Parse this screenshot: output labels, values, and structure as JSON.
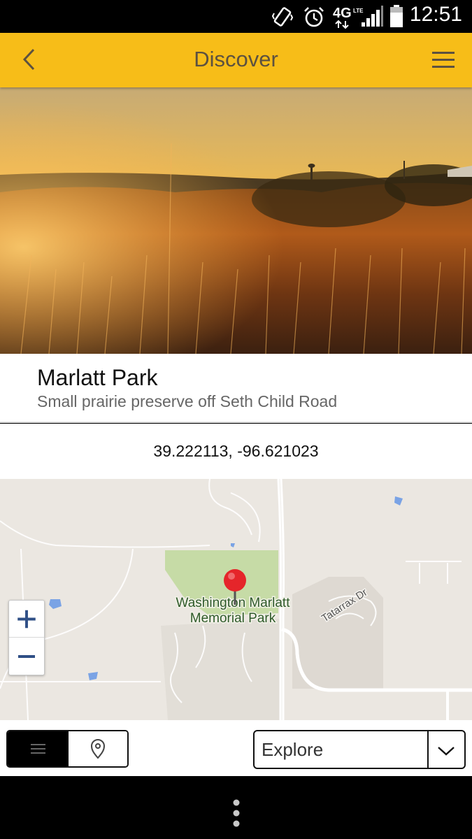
{
  "status_bar": {
    "time": "12:51",
    "network": "4G",
    "icons": [
      "vibrate-icon",
      "alarm-icon",
      "4g-lte-icon",
      "signal-icon",
      "battery-icon"
    ]
  },
  "app_bar": {
    "title": "Discover",
    "back_icon": "chevron-left-icon",
    "menu_icon": "hamburger-menu-icon",
    "color": "#f7bd18"
  },
  "place": {
    "name": "Marlatt Park",
    "description": "Small prairie preserve off Seth Child Road",
    "coordinates": "39.222113, -96.621023"
  },
  "map": {
    "park_label_line1": "Washington Marlatt",
    "park_label_line2": "Memorial Park",
    "street_label": "Tatarrax Dr",
    "zoom_in": "+",
    "zoom_out": "−",
    "marker_color": "#e5252a"
  },
  "controls": {
    "view_toggle": [
      "list-icon",
      "location-pin-icon"
    ],
    "active_view": "list",
    "explore_select": {
      "value": "Explore",
      "caret_icon": "chevron-down-icon"
    }
  },
  "navbar": {
    "menu_icon": "overflow-dots-icon"
  }
}
